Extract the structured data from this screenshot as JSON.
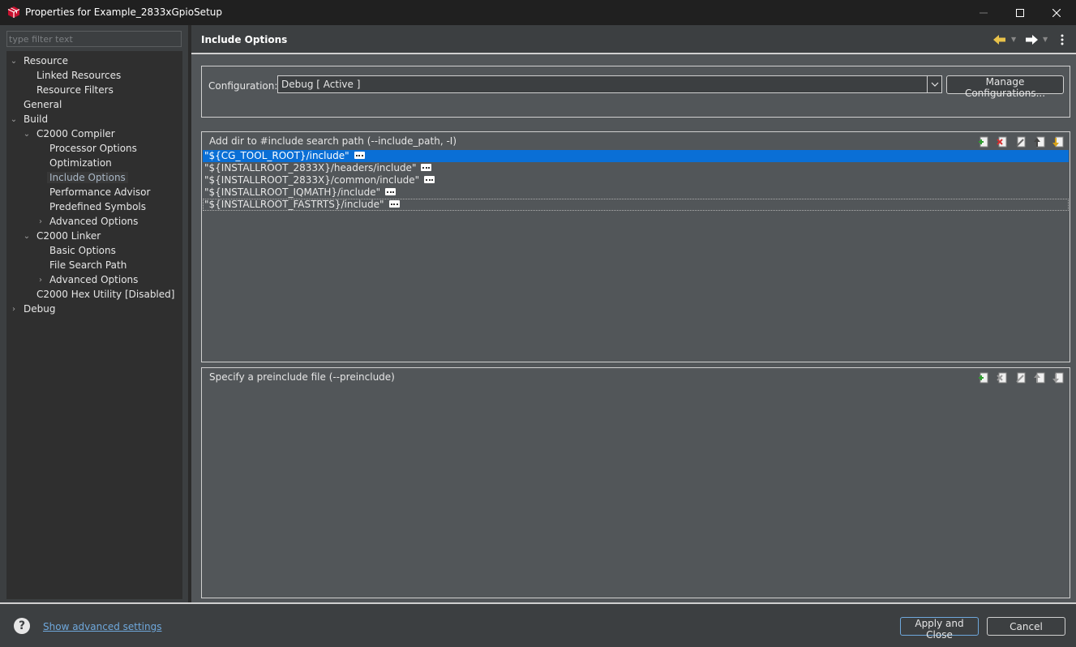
{
  "window": {
    "title": "Properties for Example_2833xGpioSetup",
    "app_icon": "ccs-cube-icon",
    "accent": "#0a6fd6"
  },
  "sidebar": {
    "filter_placeholder": "type filter text",
    "items": [
      {
        "label": "Resource",
        "expanded": true
      },
      {
        "label": "Linked Resources"
      },
      {
        "label": "Resource Filters"
      },
      {
        "label": "General"
      },
      {
        "label": "Build",
        "expanded": true
      },
      {
        "label": "C2000 Compiler",
        "expanded": true
      },
      {
        "label": "Processor Options"
      },
      {
        "label": "Optimization"
      },
      {
        "label": "Include Options",
        "selected": true
      },
      {
        "label": "Performance Advisor"
      },
      {
        "label": "Predefined Symbols"
      },
      {
        "label": "Advanced Options",
        "expanded": false
      },
      {
        "label": "C2000 Linker",
        "expanded": true
      },
      {
        "label": "Basic Options"
      },
      {
        "label": "File Search Path"
      },
      {
        "label": "Advanced Options",
        "expanded": false
      },
      {
        "label": "C2000 Hex Utility  [Disabled]"
      },
      {
        "label": "Debug",
        "expanded": false
      }
    ]
  },
  "main": {
    "title": "Include Options",
    "configuration": {
      "label": "Configuration:",
      "value": "Debug  [ Active ]",
      "manage_label": "Manage Configurations..."
    },
    "include_paths": {
      "label": "Add dir to #include search path (--include_path, -I)",
      "items": [
        "\"${CG_TOOL_ROOT}/include\"",
        "\"${INSTALLROOT_2833X}/headers/include\"",
        "\"${INSTALLROOT_2833X}/common/include\"",
        "\"${INSTALLROOT_IQMATH}/include\"",
        "\"${INSTALLROOT_FASTRTS}/include\""
      ]
    },
    "preinclude": {
      "label": "Specify a preinclude file (--preinclude)",
      "items": []
    }
  },
  "footer": {
    "advanced_link": "Show advanced settings",
    "apply_label": "Apply and Close",
    "cancel_label": "Cancel"
  }
}
